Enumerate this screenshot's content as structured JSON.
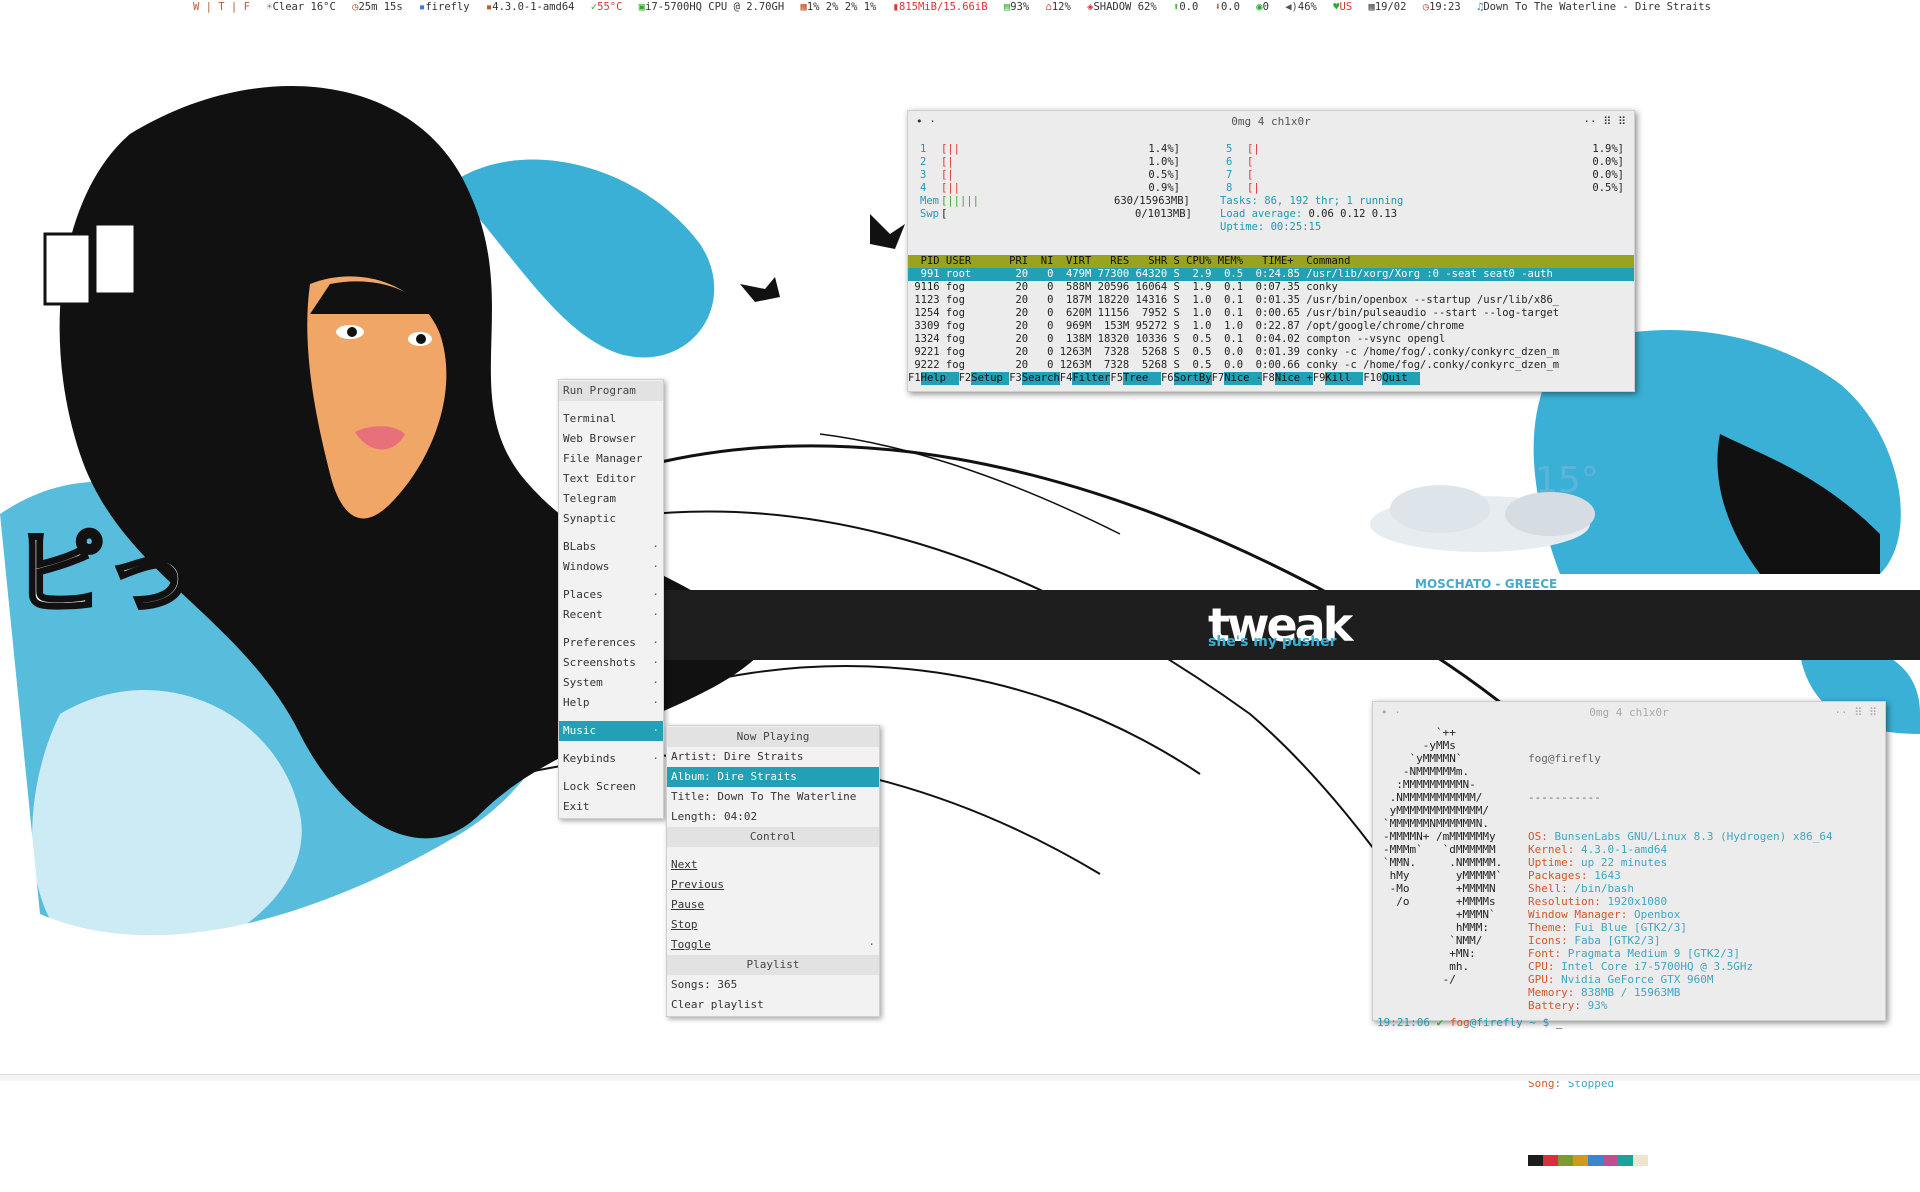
{
  "topbar": {
    "workspaces": "W | T | F",
    "weather": "Clear 16°C",
    "timer": "25m 15s",
    "host": "firefly",
    "kernel": "4.3.0-1-amd64",
    "temp": "55°C",
    "cpu": "i7-5700HQ CPU @ 2.70GH",
    "cores": "1% 2% 2% 1%",
    "mem": "815MiB/15.66iB",
    "disk": "93%",
    "home": "12%",
    "shadow": "SHADOW 62%",
    "up_rate": "0.0",
    "down_rate": "0.0",
    "mail": "0",
    "volume": "46%",
    "kbd": "US",
    "date": "19/02",
    "time": "19:23",
    "song": "Down To The Waterline - Dire Straits"
  },
  "wallpaper": {
    "weather_temp": "15°",
    "location": "MOSCHATO - GREECE",
    "brand": "tweak",
    "tagline": "she's my pusher",
    "colors": {
      "cyan": "#3bb0d6",
      "black": "#111111",
      "band": "#1e1e1e"
    }
  },
  "htop": {
    "title": "0mg 4 ch1x0r",
    "cpus": [
      {
        "n": "1",
        "bar": "[||",
        "pct": "1.4%]"
      },
      {
        "n": "2",
        "bar": "[|",
        "pct": "1.0%]"
      },
      {
        "n": "3",
        "bar": "[|",
        "pct": "0.5%]"
      },
      {
        "n": "4",
        "bar": "[||",
        "pct": "0.9%]"
      },
      {
        "n": "5",
        "bar": "[|",
        "pct": "1.9%]"
      },
      {
        "n": "6",
        "bar": "[",
        "pct": "0.0%]"
      },
      {
        "n": "7",
        "bar": "[",
        "pct": "0.0%]"
      },
      {
        "n": "8",
        "bar": "[|",
        "pct": "0.5%]"
      }
    ],
    "mem": {
      "label": "Mem",
      "bar": "[|||||",
      "value": "630/15963MB]"
    },
    "swp": {
      "label": "Swp",
      "bar": "[",
      "value": "0/1013MB]"
    },
    "tasks": {
      "label": "Tasks:",
      "value": "86, 192 thr; 1 running"
    },
    "load": {
      "label": "Load average:",
      "value": "0.06 0.12 0.13"
    },
    "uptime": {
      "label": "Uptime:",
      "value": "00:25:15"
    },
    "header": "  PID USER      PRI  NI  VIRT   RES   SHR S CPU% MEM%   TIME+  Command",
    "processes": [
      "  991 root       20   0  479M 77300 64320 S  2.9  0.5  0:24.85 /usr/lib/xorg/Xorg :0 -seat seat0 -auth",
      " 9116 fog        20   0  588M 20596 16064 S  1.9  0.1  0:07.35 conky",
      " 1123 fog        20   0  187M 18220 14316 S  1.0  0.1  0:01.35 /usr/bin/openbox --startup /usr/lib/x86_",
      " 1254 fog        20   0  620M 11156  7952 S  1.0  0.1  0:00.65 /usr/bin/pulseaudio --start --log-target",
      " 3309 fog        20   0  969M  153M 95272 S  1.0  1.0  0:22.87 /opt/google/chrome/chrome",
      " 1324 fog        20   0  138M 18320 10336 S  0.5  0.1  0:04.02 compton --vsync opengl",
      " 9221 fog        20   0 1263M  7328  5268 S  0.5  0.0  0:01.39 conky -c /home/fog/.conky/conkyrc_dzen_m",
      " 9222 fog        20   0 1263M  7328  5268 S  0.5  0.0  0:00.66 conky -c /home/fog/.conky/conkyrc_dzen_m"
    ],
    "fkeys": [
      {
        "k": "F1",
        "v": "Help  "
      },
      {
        "k": "F2",
        "v": "Setup "
      },
      {
        "k": "F3",
        "v": "Search"
      },
      {
        "k": "F4",
        "v": "Filter"
      },
      {
        "k": "F5",
        "v": "Tree  "
      },
      {
        "k": "F6",
        "v": "SortBy"
      },
      {
        "k": "F7",
        "v": "Nice -"
      },
      {
        "k": "F8",
        "v": "Nice +"
      },
      {
        "k": "F9",
        "v": "Kill  "
      },
      {
        "k": "F10",
        "v": "Quit  "
      }
    ]
  },
  "neofetch": {
    "title": "0mg 4 ch1x0r",
    "ascii": "        `++\n      -yMMs\n    `yMMMMN`\n   -NMMMMMMm.\n  :MMMMMMMMMN-\n .NMMMMMMMMMMM/\n yMMMMMMMMMMMMM/\n`MMMMMMNMMMMMMN.\n-MMMMN+ /mMMMMMMy\n-MMMm`   `dMMMMMM\n`MMN.     .NMMMMM.\n hMy       yMMMMM`\n -Mo       +MMMMN\n  /o       +MMMMs\n           +MMMN`\n           hMMM:\n          `NMM/\n          +MN:\n          mh.\n         -/",
    "user": "fog@firefly",
    "underline": "-----------",
    "fields": [
      {
        "k": "OS:",
        "v": "BunsenLabs GNU/Linux 8.3 (Hydrogen) x86_64"
      },
      {
        "k": "Kernel:",
        "v": "4.3.0-1-amd64"
      },
      {
        "k": "Uptime:",
        "v": "up 22 minutes"
      },
      {
        "k": "Packages:",
        "v": "1643"
      },
      {
        "k": "Shell:",
        "v": "/bin/bash"
      },
      {
        "k": "Resolution:",
        "v": "1920x1080"
      },
      {
        "k": "Window Manager:",
        "v": "Openbox"
      },
      {
        "k": "Theme:",
        "v": "Fui Blue [GTK2/3]"
      },
      {
        "k": "Icons:",
        "v": "Faba [GTK2/3]"
      },
      {
        "k": "Font:",
        "v": "Pragmata Medium 9 [GTK2/3]"
      },
      {
        "k": "CPU:",
        "v": "Intel Core i7-5700HQ @ 3.5GHz"
      },
      {
        "k": "GPU:",
        "v": "Nvidia GeForce GTX 960M"
      },
      {
        "k": "Memory:",
        "v": "838MB / 15963MB"
      },
      {
        "k": "Battery:",
        "v": "93%"
      }
    ],
    "song": {
      "k": "Song:",
      "v": "Stopped"
    },
    "palette": [
      "#1d1d1d",
      "#d7303a",
      "#7e9a2c",
      "#d19a1c",
      "#3a86cc",
      "#c24d8d",
      "#1aa39a",
      "#ede5cf"
    ],
    "prompt": {
      "time": "19:21:06",
      "check": "✔",
      "user": "fog",
      "host": "@firefly",
      "path": "~ $",
      "cursor": "_"
    }
  },
  "main_menu": {
    "items": [
      {
        "label": "Run Program",
        "type": "header"
      },
      {
        "type": "sep"
      },
      {
        "label": "Terminal"
      },
      {
        "label": "Web Browser"
      },
      {
        "label": "File Manager"
      },
      {
        "label": "Text Editor"
      },
      {
        "label": "Telegram"
      },
      {
        "label": "Synaptic"
      },
      {
        "type": "sep"
      },
      {
        "label": "BLabs",
        "sub": true
      },
      {
        "label": "Windows",
        "sub": true
      },
      {
        "type": "sep"
      },
      {
        "label": "Places",
        "sub": true
      },
      {
        "label": "Recent",
        "sub": true
      },
      {
        "type": "sep"
      },
      {
        "label": "Preferences",
        "sub": true
      },
      {
        "label": "Screenshots",
        "sub": true
      },
      {
        "label": "System",
        "sub": true
      },
      {
        "label": "Help",
        "sub": true
      },
      {
        "type": "sep"
      },
      {
        "label": "Music",
        "sub": true,
        "active": true
      },
      {
        "type": "sep"
      },
      {
        "label": "Keybinds",
        "sub": true
      },
      {
        "type": "sep"
      },
      {
        "label": "Lock Screen"
      },
      {
        "label": "Exit"
      }
    ]
  },
  "music_menu": {
    "now_playing_header": "Now Playing",
    "artist": "Artist: Dire Straits",
    "album": "Album: Dire Straits",
    "title": "Title:  Down To The Waterline",
    "length": "Length:  04:02",
    "control_header": "Control",
    "controls": [
      "Next",
      "Previous",
      "Pause",
      "Stop",
      "Toggle"
    ],
    "playlist_header": "Playlist",
    "songs": "Songs: 365",
    "clear": "Clear playlist"
  },
  "bottom_bar": {
    "color": "#f5f5f5"
  }
}
